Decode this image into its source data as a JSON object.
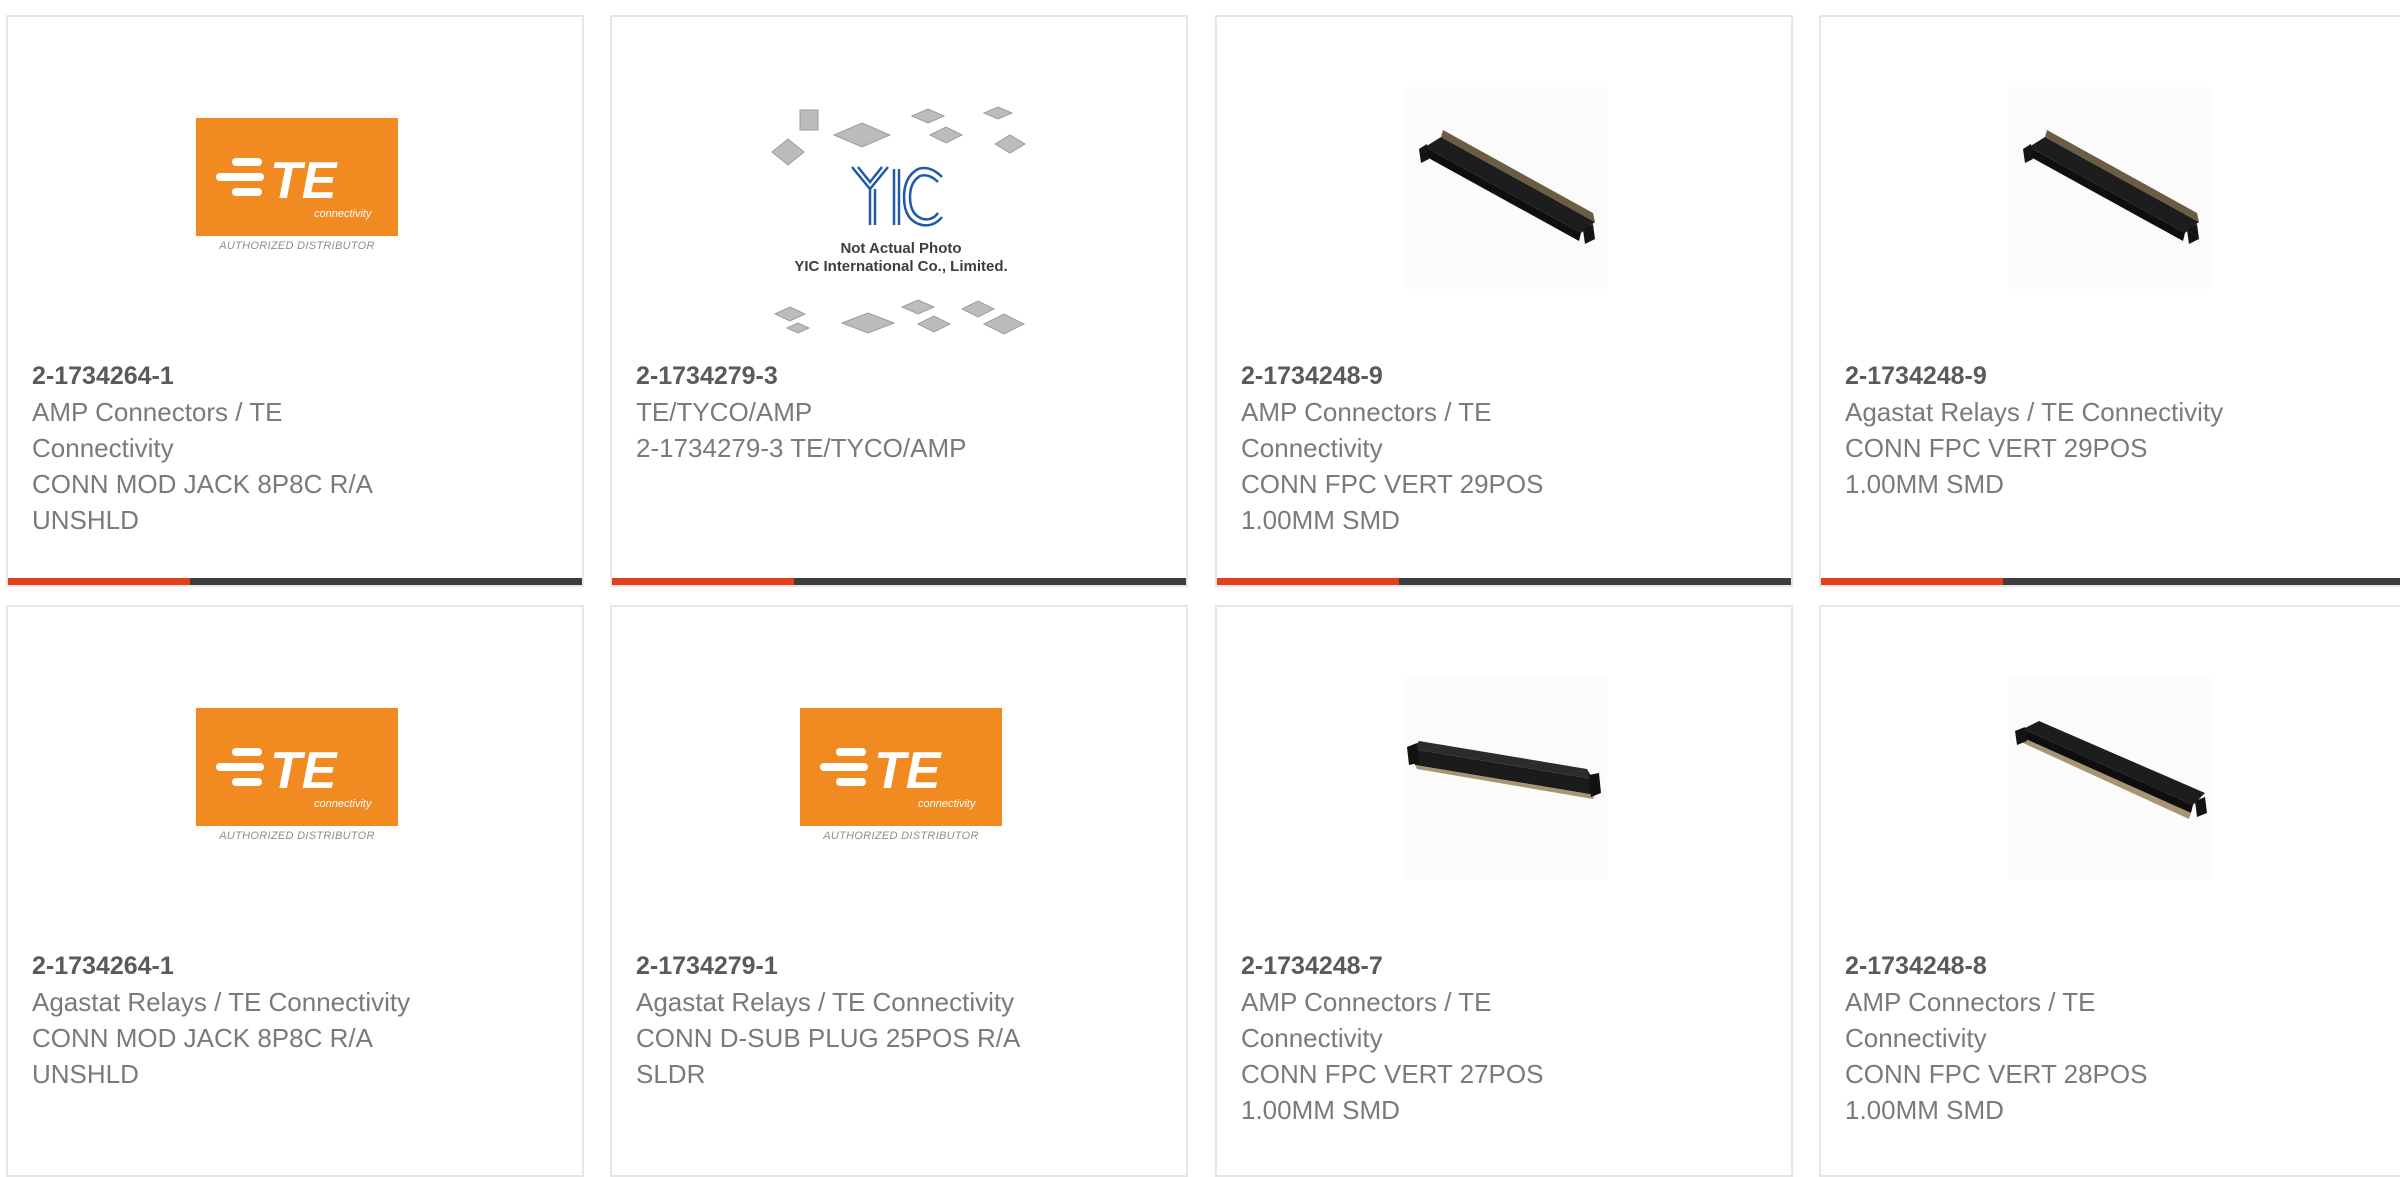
{
  "cards": [
    {
      "part": "2-1734264-1",
      "lines": [
        "AMP Connectors / TE",
        "Connectivity",
        "CONN MOD JACK 8P8C R/A",
        "UNSHLD"
      ],
      "image": "te-connectivity-logo"
    },
    {
      "part": "2-1734279-3",
      "lines": [
        "TE/TYCO/AMP",
        "2-1734279-3 TE/TYCO/AMP",
        "",
        ""
      ],
      "image": "yic-not-actual-photo"
    },
    {
      "part": "2-1734248-9",
      "lines": [
        "AMP Connectors / TE",
        "Connectivity",
        "CONN FPC VERT 29POS",
        "1.00MM SMD"
      ],
      "image": "fpc-connector-photo"
    },
    {
      "part": "2-1734248-9",
      "lines": [
        "Agastat Relays / TE Connectivity",
        "CONN FPC VERT 29POS",
        "1.00MM SMD",
        ""
      ],
      "image": "fpc-connector-photo"
    },
    {
      "part": "2-1734264-1",
      "lines": [
        "Agastat Relays / TE Connectivity",
        "CONN MOD JACK 8P8C R/A",
        "UNSHLD",
        ""
      ],
      "image": "te-connectivity-logo"
    },
    {
      "part": "2-1734279-1",
      "lines": [
        "Agastat Relays / TE Connectivity",
        "CONN D-SUB PLUG 25POS R/A",
        "SLDR",
        ""
      ],
      "image": "te-connectivity-logo"
    },
    {
      "part": "2-1734248-7",
      "lines": [
        "AMP Connectors / TE",
        "Connectivity",
        "CONN FPC VERT 27POS",
        "1.00MM SMD"
      ],
      "image": "fpc-connector-photo-alt"
    },
    {
      "part": "2-1734248-8",
      "lines": [
        "AMP Connectors / TE",
        "Connectivity",
        "CONN FPC VERT 28POS",
        "1.00MM SMD"
      ],
      "image": "fpc-connector-photo-alt"
    }
  ],
  "logos": {
    "te_wordmark": "TE",
    "te_sub": "connectivity",
    "te_caption": "AUTHORIZED DISTRIBUTOR",
    "yic_mark": "YIC",
    "yic_line1": "Not Actual Photo",
    "yic_line2": "YIC International Co., Limited."
  },
  "colors": {
    "accent": "#e2401c",
    "bar": "#3d3d3d",
    "te_orange": "#f18a21",
    "part_text": "#5a5a5a",
    "body_text": "#7a7a7a",
    "yic_blue": "#1e5aa8"
  }
}
